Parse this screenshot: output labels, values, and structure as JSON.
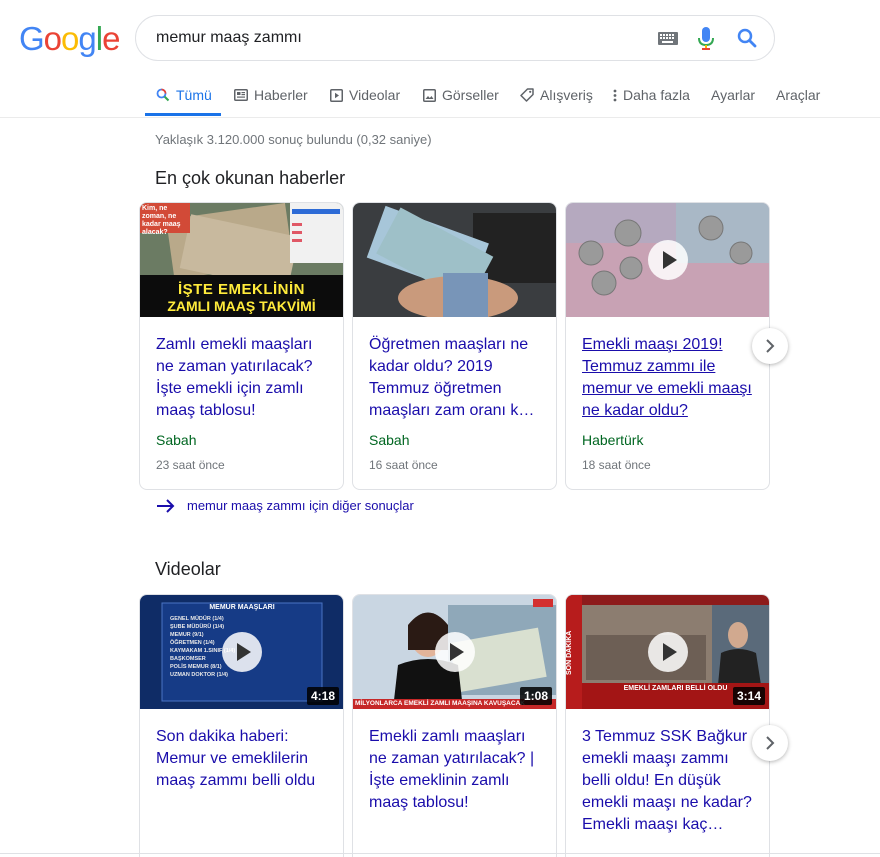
{
  "logo": {
    "letters": [
      "G",
      "o",
      "o",
      "g",
      "l",
      "e"
    ],
    "colors": [
      "#4285f4",
      "#ea4335",
      "#fbbc05",
      "#4285f4",
      "#34a853",
      "#ea4335"
    ]
  },
  "search": {
    "query": "memur maaş zammı"
  },
  "tabs": [
    {
      "label": "Tümü",
      "icon": "search-icon"
    },
    {
      "label": "Haberler",
      "icon": "news-icon"
    },
    {
      "label": "Videolar",
      "icon": "video-icon"
    },
    {
      "label": "Görseller",
      "icon": "image-icon"
    },
    {
      "label": "Alışveriş",
      "icon": "tag-icon"
    },
    {
      "label": "Daha fazla",
      "icon": "more-vert-icon"
    },
    {
      "label": "Ayarlar"
    },
    {
      "label": "Araçlar"
    }
  ],
  "stats": "Yaklaşık 3.120.000 sonuç bulundu (0,32 saniye)",
  "news": {
    "heading": "En çok okunan haberler",
    "cards": [
      {
        "title": "Zamlı emekli maaşları ne zaman yatırılacak? İşte emekli için zamlı maaş tablosu!",
        "source": "Sabah",
        "time": "23 saat önce",
        "thumb_text_1": "İŞTE EMEKLİNİN",
        "thumb_text_2": "ZAMLI MAAŞ TAKVİMİ",
        "thumb_badge": "Kim, ne zoman, ne kadar maaş alacak?"
      },
      {
        "title": "Öğretmen maaşları ne kadar oldu? 2019 Temmuz öğretmen maaşları zam oranı k…",
        "source": "Sabah",
        "time": "16 saat önce"
      },
      {
        "title": "Emekli maaşı 2019! Temmuz zammı ile memur ve emekli maaşı ne kadar oldu?",
        "source": "Habertürk",
        "time": "18 saat önce"
      }
    ],
    "more_link": "memur maaş zammı için diğer sonuçlar"
  },
  "videos": {
    "heading": "Videolar",
    "cards": [
      {
        "title": "Son dakika haberi: Memur ve emeklilerin maaş zammı belli oldu",
        "duration": "4:18",
        "thumb_header": "MEMUR MAAŞLARI",
        "thumb_rows": [
          "GENEL MÜDÜR (1/4)",
          "ŞUBE MÜDÜRÜ (1/4)",
          "MEMUR (9/1)",
          "ÖĞRETMEN (1/4)",
          "KAYMAKAM 1.SINIF (1/4)",
          "BAŞKOMSER",
          "POLİS MEMUR (8/1)",
          "UZMAN DOKTOR (1/4)"
        ]
      },
      {
        "title": "Emekli zamlı maaşları ne zaman yatırılacak? | İşte emeklinin zamlı maaş tablosu!",
        "duration": "1:08",
        "thumb_ticker": "MİLYONLARCA EMEKLİ ZAMLI MAAŞINA KAVUŞACAK"
      },
      {
        "title": "3 Temmuz SSK Bağkur emekli maaşı zammı belli oldu! En düşük emekli maaşı ne kadar? Emekli maaşı kaç…",
        "duration": "3:14",
        "thumb_ticker": "EMEKLİ ZAMLARI BELLİ OLDU",
        "thumb_side": "SON DAKİKA"
      }
    ]
  }
}
